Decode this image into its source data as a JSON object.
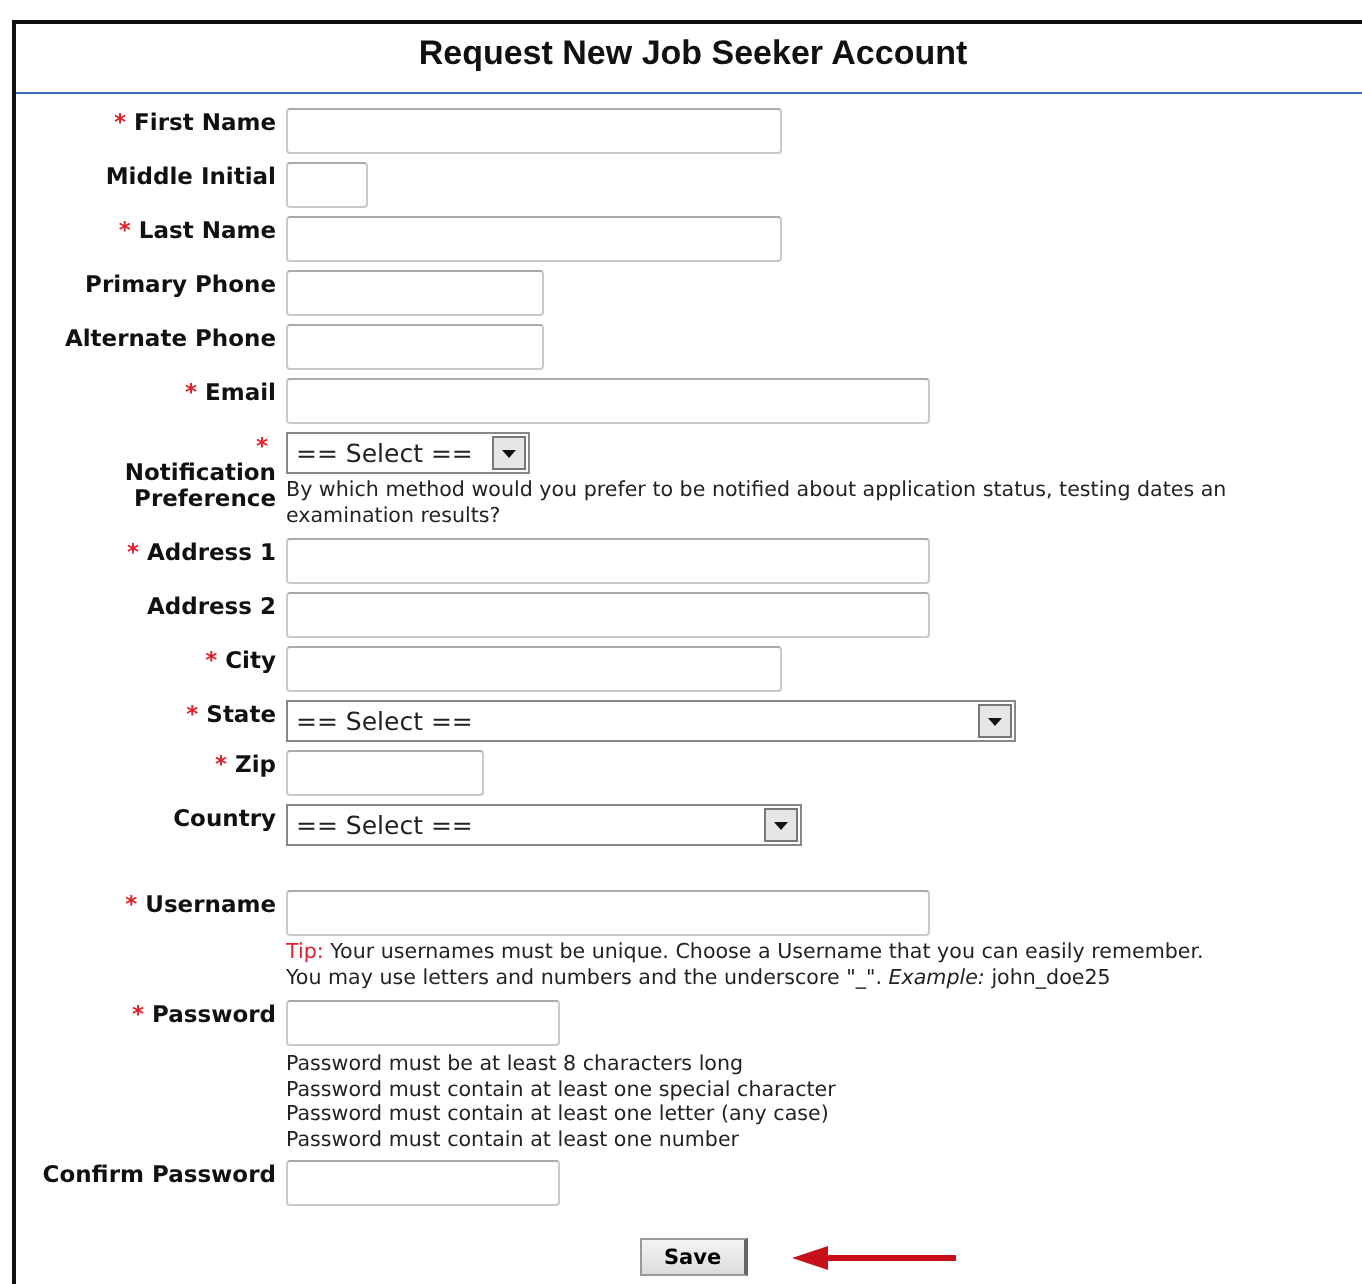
{
  "title": "Request New Job Seeker Account",
  "fields": [
    {
      "label": "First Name",
      "marker": "*",
      "kind": "text"
    },
    {
      "label": "Middle Initial",
      "kind": "text"
    },
    {
      "label": "Last Name",
      "marker": "*",
      "kind": "text"
    },
    {
      "label": "Primary Phone",
      "kind": "text"
    },
    {
      "label": "Alternate Phone",
      "kind": "text"
    },
    {
      "label": "Email",
      "marker": "*",
      "kind": "text"
    },
    {
      "label": "Notification Preference",
      "marker": "*",
      "kind": "select",
      "value": "== Select ==",
      "help": "By which method would you prefer to be notified about application status, testing dates an\nexamination results?"
    },
    {
      "label": "Address 1",
      "marker": "*",
      "kind": "text"
    },
    {
      "label": "Address 2",
      "kind": "text"
    },
    {
      "label": "City",
      "marker": "*",
      "kind": "text"
    },
    {
      "label": "State",
      "marker": "*",
      "kind": "select",
      "value": "== Select =="
    },
    {
      "label": "Zip",
      "marker": "*",
      "kind": "text"
    },
    {
      "label": "Country",
      "kind": "select",
      "value": "== Select =="
    },
    {
      "label": "Username",
      "marker": "*",
      "kind": "text",
      "tip_label": "Tip:",
      "tip": "Your usernames must be unique. Choose a Username that you can easily remember.\nYou may use letters and numbers and the underscore \"_\". *Example:* john_doe25"
    },
    {
      "label": "Password",
      "marker": "*",
      "kind": "text",
      "notes": [
        "Password must be at least 8 characters long",
        "Password must contain at least one special character",
        "Password must contain at least one letter (any case)",
        "Password must contain at least one number"
      ]
    },
    {
      "label": "Confirm Password",
      "kind": "text"
    }
  ],
  "save_button": "Save"
}
